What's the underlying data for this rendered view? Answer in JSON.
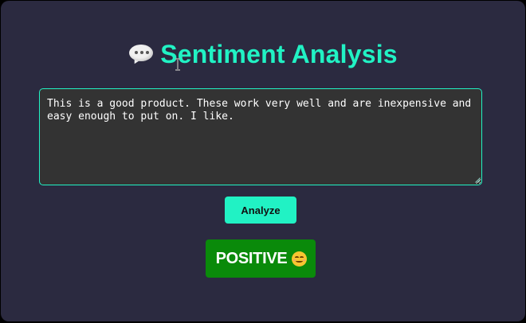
{
  "header": {
    "title": "Sentiment Analysis",
    "icon": "speech-bubble-icon"
  },
  "input": {
    "value": "This is a good product. These work very well and are inexpensive and easy enough to put on. I like."
  },
  "actions": {
    "analyze_label": "Analyze"
  },
  "result": {
    "label": "POSITIVE",
    "icon": "smiley-icon"
  },
  "colors": {
    "background": "#2b2a40",
    "accent": "#21f2c4",
    "textarea_bg": "#333333",
    "positive": "#0a8a0a"
  }
}
